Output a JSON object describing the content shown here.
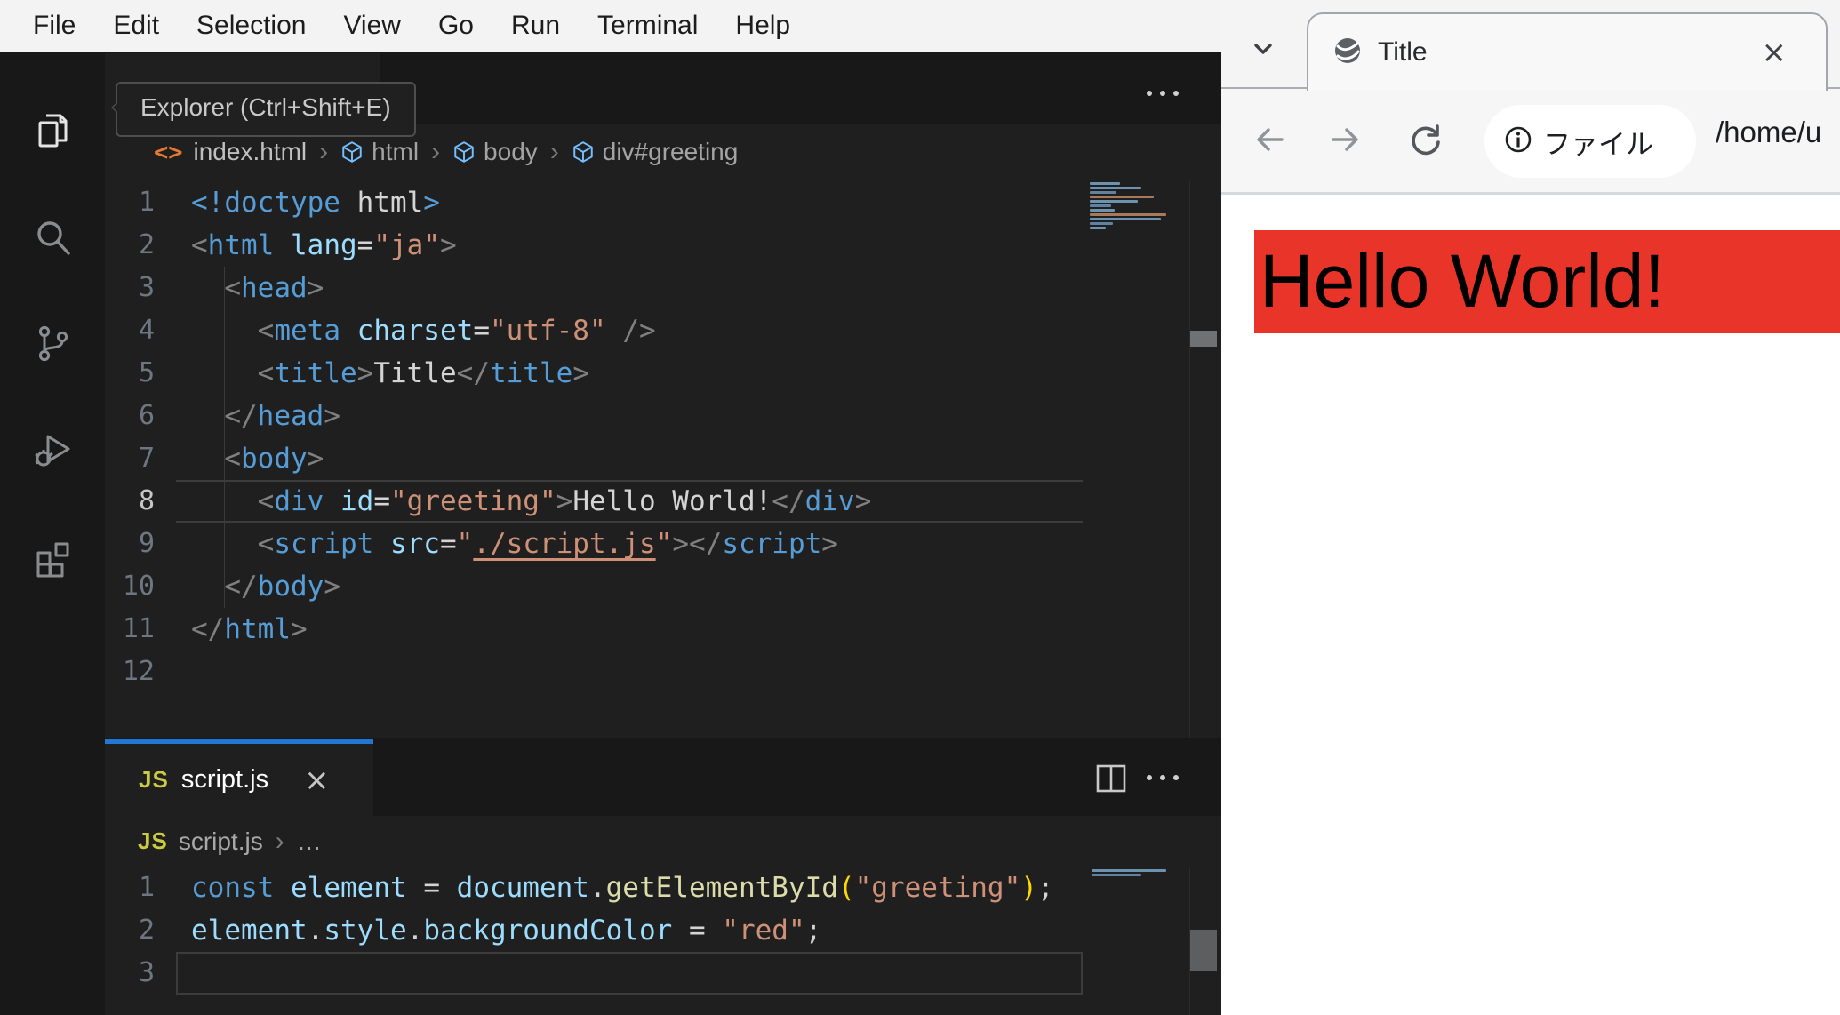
{
  "colors": {
    "accent_blue": "#2178d4",
    "editor_bg": "#1f1f1f",
    "header_bg": "#181818",
    "red_banner": "#e93529",
    "js_badge": "#cbcb41"
  },
  "menu_bar": {
    "items": [
      "File",
      "Edit",
      "Selection",
      "View",
      "Go",
      "Run",
      "Terminal",
      "Help"
    ]
  },
  "activity_bar": {
    "tooltip": "Explorer (Ctrl+Shift+E)",
    "icons": [
      "explorer",
      "search",
      "source-control",
      "run-and-debug",
      "extensions"
    ]
  },
  "editor_top": {
    "breadcrumb": {
      "file": "index.html",
      "separator": "›",
      "segments": [
        "html",
        "body",
        "div#greeting"
      ]
    },
    "active_line": 8,
    "active_style": "hlines",
    "active_num_bright": true,
    "lines": [
      {
        "n": "1",
        "tokens": [
          [
            "<!doctype ",
            "t"
          ],
          [
            "html",
            "x"
          ],
          [
            ">",
            "t"
          ]
        ]
      },
      {
        "n": "2",
        "tokens": [
          [
            "<",
            "p"
          ],
          [
            "html",
            "t"
          ],
          [
            " ",
            "x"
          ],
          [
            "lang",
            "a"
          ],
          [
            "=",
            "x"
          ],
          [
            "\"ja\"",
            "s"
          ],
          [
            ">",
            "p"
          ]
        ]
      },
      {
        "n": "3",
        "tokens": [
          [
            "  ",
            "x"
          ],
          [
            "<",
            "p"
          ],
          [
            "head",
            "t"
          ],
          [
            ">",
            "p"
          ]
        ]
      },
      {
        "n": "4",
        "tokens": [
          [
            "    ",
            "x"
          ],
          [
            "<",
            "p"
          ],
          [
            "meta",
            "t"
          ],
          [
            " ",
            "x"
          ],
          [
            "charset",
            "a"
          ],
          [
            "=",
            "x"
          ],
          [
            "\"utf-8\"",
            "s"
          ],
          [
            " ",
            "x"
          ],
          [
            "/>",
            "p"
          ]
        ]
      },
      {
        "n": "5",
        "tokens": [
          [
            "    ",
            "x"
          ],
          [
            "<",
            "p"
          ],
          [
            "title",
            "t"
          ],
          [
            ">",
            "p"
          ],
          [
            "Title",
            "x"
          ],
          [
            "</",
            "p"
          ],
          [
            "title",
            "t"
          ],
          [
            ">",
            "p"
          ]
        ]
      },
      {
        "n": "6",
        "tokens": [
          [
            "  ",
            "x"
          ],
          [
            "</",
            "p"
          ],
          [
            "head",
            "t"
          ],
          [
            ">",
            "p"
          ]
        ]
      },
      {
        "n": "7",
        "tokens": [
          [
            "  ",
            "x"
          ],
          [
            "<",
            "p"
          ],
          [
            "body",
            "t"
          ],
          [
            ">",
            "p"
          ]
        ]
      },
      {
        "n": "8",
        "tokens": [
          [
            "    ",
            "x"
          ],
          [
            "<",
            "p"
          ],
          [
            "div",
            "t"
          ],
          [
            " ",
            "x"
          ],
          [
            "id",
            "a"
          ],
          [
            "=",
            "x"
          ],
          [
            "\"greeting\"",
            "s"
          ],
          [
            ">",
            "p"
          ],
          [
            "Hello World!",
            "x"
          ],
          [
            "</",
            "p"
          ],
          [
            "div",
            "t"
          ],
          [
            ">",
            "p"
          ]
        ]
      },
      {
        "n": "9",
        "tokens": [
          [
            "    ",
            "x"
          ],
          [
            "<",
            "p"
          ],
          [
            "script",
            "t"
          ],
          [
            " ",
            "x"
          ],
          [
            "src",
            "a"
          ],
          [
            "=",
            "x"
          ],
          [
            "\"",
            "s"
          ],
          [
            "./script.js",
            "l"
          ],
          [
            "\"",
            "s"
          ],
          [
            ">",
            "p"
          ],
          [
            "</",
            "p"
          ],
          [
            "script",
            "t"
          ],
          [
            ">",
            "p"
          ]
        ]
      },
      {
        "n": "10",
        "tokens": [
          [
            "  ",
            "x"
          ],
          [
            "</",
            "p"
          ],
          [
            "body",
            "t"
          ],
          [
            ">",
            "p"
          ]
        ]
      },
      {
        "n": "11",
        "tokens": [
          [
            "</",
            "p"
          ],
          [
            "html",
            "t"
          ],
          [
            ">",
            "p"
          ]
        ]
      },
      {
        "n": "12",
        "tokens": []
      }
    ]
  },
  "editor_bottom": {
    "tab": {
      "icon": "JS",
      "label": "script.js",
      "close": "×"
    },
    "breadcrumb": {
      "icon": "JS",
      "file": "script.js",
      "separator": "›",
      "more": "…"
    },
    "active_line": 3,
    "active_style": "box",
    "active_num_bright": false,
    "lines": [
      {
        "n": "1",
        "tokens": [
          [
            "const",
            "k"
          ],
          [
            " ",
            "x"
          ],
          [
            "element",
            "v"
          ],
          [
            " = ",
            "x"
          ],
          [
            "document",
            "v"
          ],
          [
            ".",
            "x"
          ],
          [
            "getElementById",
            "f"
          ],
          [
            "(",
            "b"
          ],
          [
            "\"greeting\"",
            "s"
          ],
          [
            ")",
            "b"
          ],
          [
            ";",
            "x"
          ]
        ]
      },
      {
        "n": "2",
        "tokens": [
          [
            "element",
            "v"
          ],
          [
            ".",
            "x"
          ],
          [
            "style",
            "v"
          ],
          [
            ".",
            "x"
          ],
          [
            "backgroundColor",
            "v"
          ],
          [
            " = ",
            "x"
          ],
          [
            "\"red\"",
            "s"
          ],
          [
            ";",
            "x"
          ]
        ]
      },
      {
        "n": "3",
        "tokens": []
      }
    ]
  },
  "browser": {
    "tab": {
      "title": "Title",
      "close": "×"
    },
    "toolbar": {
      "url_chip": "ファイル",
      "url_path": "/home/u"
    },
    "page": {
      "text": "Hello World!"
    }
  }
}
